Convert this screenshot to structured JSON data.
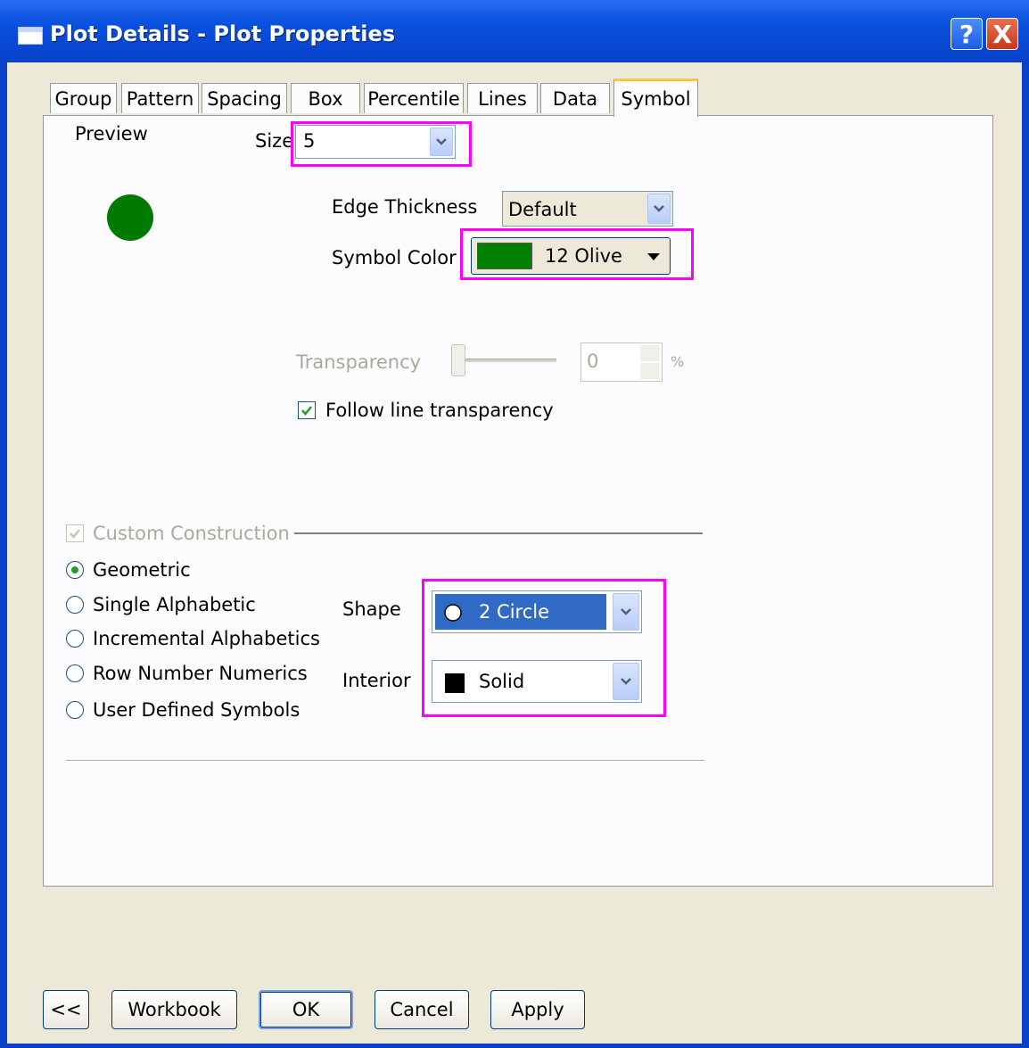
{
  "window": {
    "title": "Plot Details - Plot Properties",
    "help_label": "?",
    "close_label": "X"
  },
  "tabs": [
    "Group",
    "Pattern",
    "Spacing",
    "Box",
    "Percentile",
    "Lines",
    "Data",
    "Symbol"
  ],
  "active_tab": "Symbol",
  "preview": {
    "label": "Preview",
    "symbol_color": "#007a00"
  },
  "size": {
    "label": "Size",
    "value": "5"
  },
  "edge_thickness": {
    "label": "Edge Thickness",
    "value": "Default"
  },
  "symbol_color": {
    "label": "Symbol Color",
    "value": "12 Olive",
    "swatch": "#008000"
  },
  "transparency": {
    "label": "Transparency",
    "value": "0",
    "unit": "%"
  },
  "follow_line_transparency": {
    "label": "Follow line transparency",
    "checked": true
  },
  "custom_construction": {
    "label": "Custom Construction",
    "checked": true
  },
  "construction_options": [
    "Geometric",
    "Single Alphabetic",
    "Incremental Alphabetics",
    "Row Number Numerics",
    "User Defined Symbols"
  ],
  "selected_construction": "Geometric",
  "shape": {
    "label": "Shape",
    "value": "2 Circle"
  },
  "interior": {
    "label": "Interior",
    "value": "Solid"
  },
  "buttons": {
    "back": "<<",
    "workbook": "Workbook",
    "ok": "OK",
    "cancel": "Cancel",
    "apply": "Apply"
  }
}
